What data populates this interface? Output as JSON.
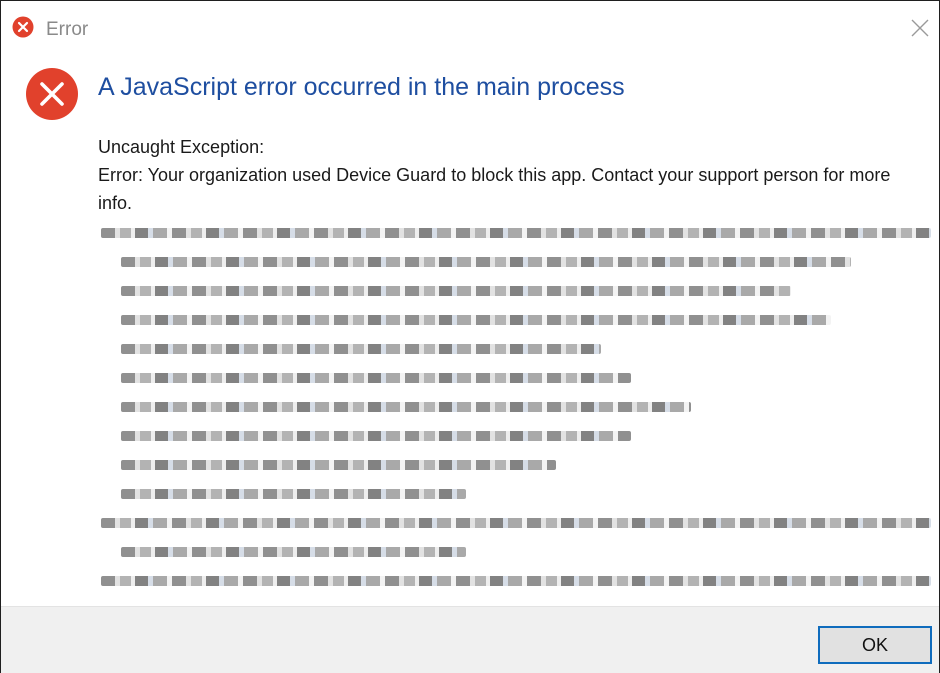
{
  "window": {
    "title": "Error",
    "close_icon": "close-icon"
  },
  "dialog": {
    "icon": "error-icon",
    "headline": "A JavaScript error occurred in the main process",
    "message_line1": "Uncaught Exception:",
    "message_line2": "Error: Your organization used Device Guard to block this app. Contact your support person for more info."
  },
  "details": {
    "content": "blurred-stack-trace",
    "line_count": 13
  },
  "footer": {
    "ok_label": "OK"
  },
  "colors": {
    "error_red": "#e1412c",
    "headline_blue": "#1e4ea0",
    "button_border": "#0f6cbd",
    "footer_bg": "#f0f0f0"
  }
}
